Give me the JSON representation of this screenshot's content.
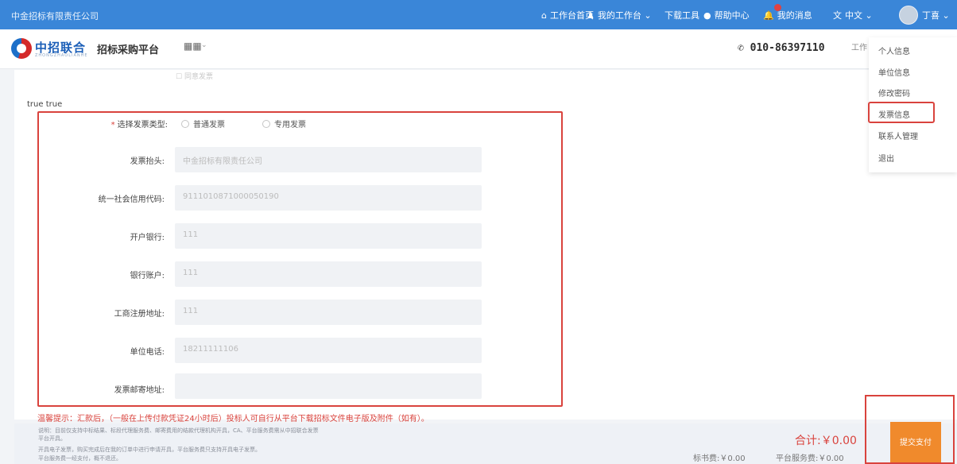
{
  "topbar": {
    "company": "中金招标有限责任公司",
    "nav": [
      {
        "icon": "home-icon",
        "glyph": "⌂",
        "label": "工作台首页"
      },
      {
        "icon": "user-icon",
        "glyph": "♟",
        "label": "我的工作台 ⌄"
      },
      {
        "icon": "download-icon",
        "glyph": "",
        "label": "下载工具"
      },
      {
        "icon": "help-icon",
        "glyph": "●",
        "label": "帮助中心"
      },
      {
        "icon": "bell-icon",
        "glyph": "🔔",
        "label": "我的消息"
      },
      {
        "icon": "language-icon",
        "glyph": "文",
        "label": "中文 ⌄"
      }
    ],
    "user_name": "丁喜 ⌄"
  },
  "header": {
    "logo_name": "中招联合",
    "logo_sub": "ZHONGZHAOLIANHE",
    "platform": "招标采购平台",
    "app_grid": "▦▦",
    "phone": "010-86397110",
    "work_link": "工作"
  },
  "dropdown": {
    "items": [
      "个人信息",
      "单位信息",
      "修改密码",
      "发票信息",
      "联系人管理",
      "退出"
    ],
    "active_index": 3
  },
  "main": {
    "faded_text": "同意发票",
    "section_label": "true true",
    "invoice_type_label": "选择发票类型:",
    "invoice_type_options": [
      "普通发票",
      "专用发票"
    ],
    "fields": [
      {
        "label": "发票抬头:",
        "value": "中金招标有限责任公司"
      },
      {
        "label": "统一社会信用代码:",
        "value": "9111010871000050190"
      },
      {
        "label": "开户银行:",
        "value": "111"
      },
      {
        "label": "银行账户:",
        "value": "111"
      },
      {
        "label": "工商注册地址:",
        "value": "111"
      },
      {
        "label": "单位电话:",
        "value": "18211111106"
      },
      {
        "label": "发票邮寄地址:",
        "value": ""
      }
    ],
    "warning": "温馨提示：汇款后，（一般在上传付款凭证24小时后）投标人可自行从平台下载招标文件电子版及附件（如有）。"
  },
  "bottom": {
    "notes": [
      "说明：目前仅支持中标结果、标段代理服务费、邮寄费用的结款代理机构开具，CA、平台服务费需从中招联合发票",
      "平台开具。",
      "    开具电子发票，购买完成后在我的订单中进行申请开具，平台服务费只支持开具电子发票。",
      "    平台服务费一经支付，概不退还。"
    ],
    "doc_fee": "标书费:￥0.00",
    "total": "合计:￥0.00",
    "platform_fee": "平台服务费:￥0.00",
    "submit_label": "提交支付"
  },
  "colors": {
    "topbar": "#3a86d8",
    "highlight_border": "#d9433d",
    "submit_button": "#f08a2c"
  }
}
